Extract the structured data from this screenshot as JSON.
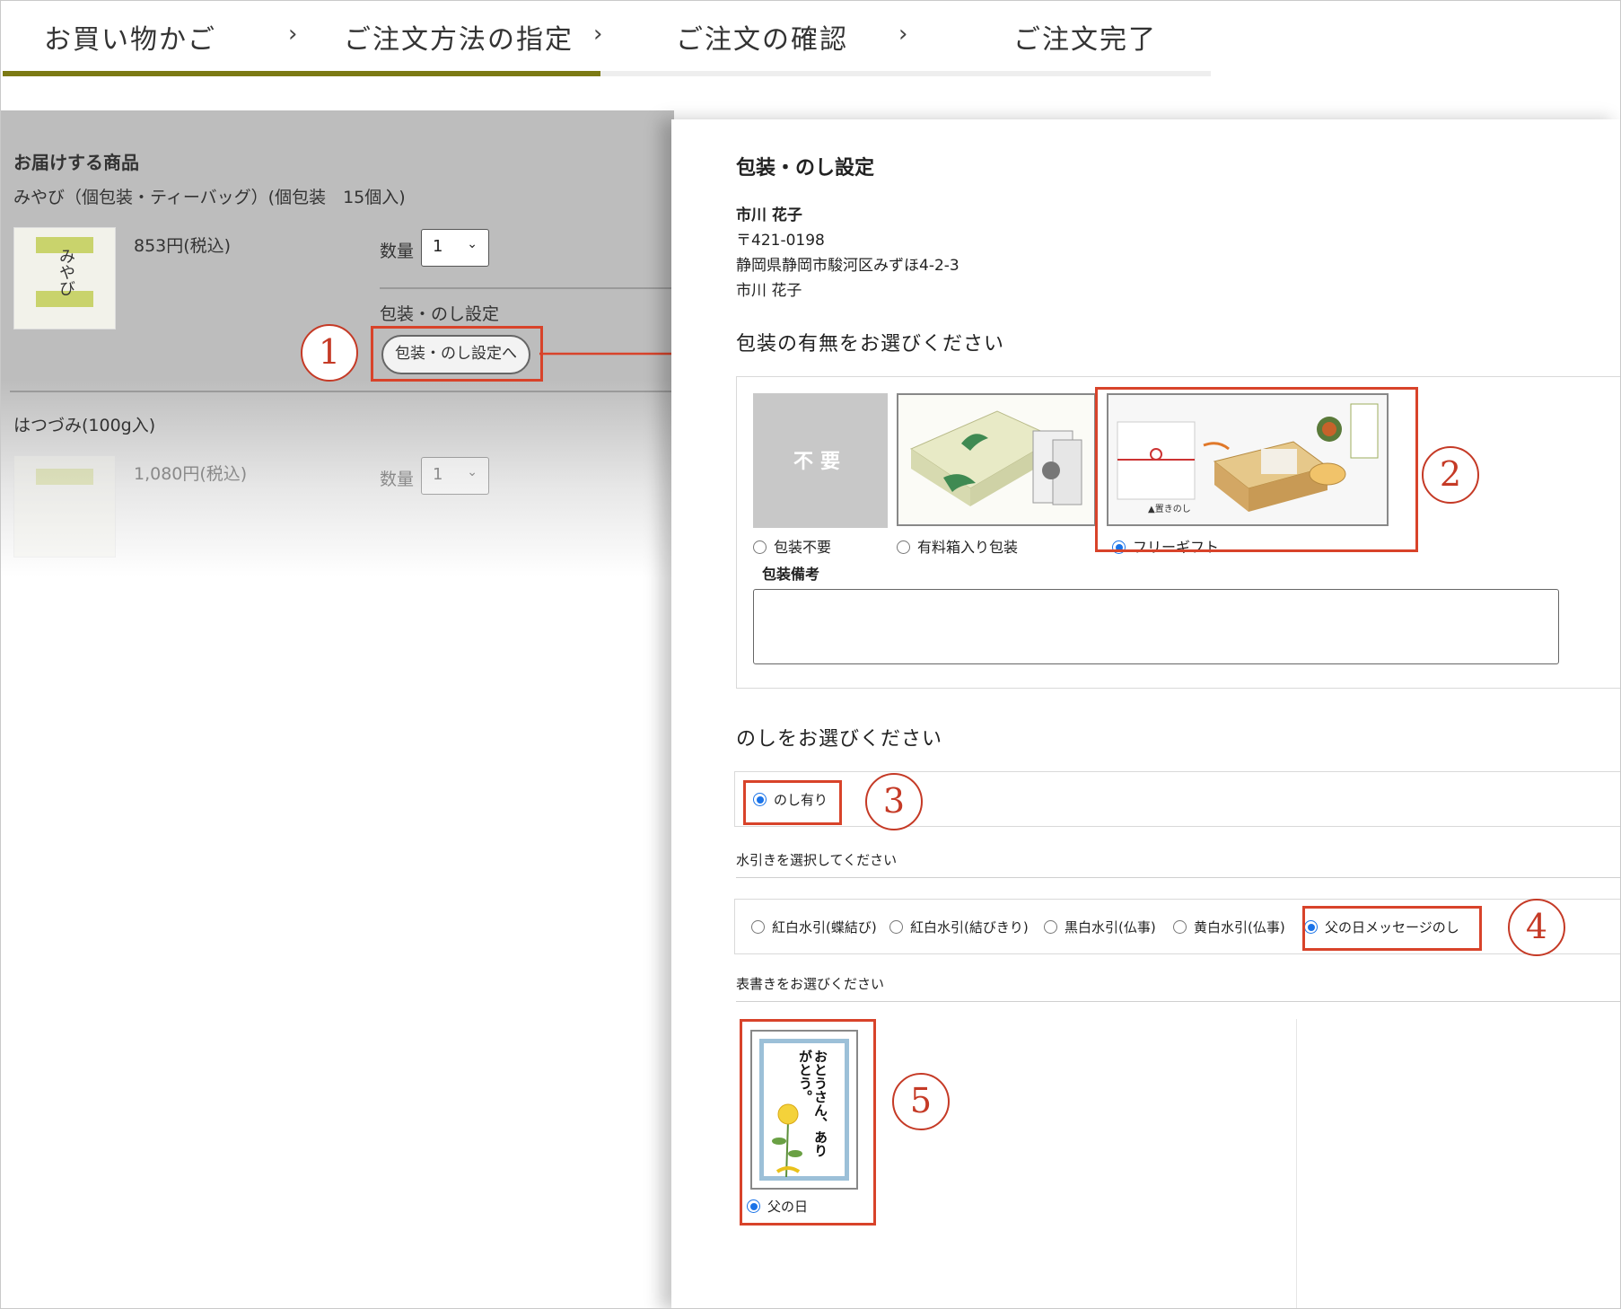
{
  "steps": {
    "items": [
      "お買い物かご",
      "ご注文方法の指定",
      "ご注文の確認",
      "ご注文完了"
    ],
    "chevron": "›"
  },
  "cart": {
    "section_title": "お届けする商品",
    "item1": {
      "name": "みやび（個包装・ティーバッグ）(個包装　15個入)",
      "price": "853円(税込)",
      "qty_label": "数量",
      "qty_value": "1",
      "wrap_label": "包装・のし設定",
      "wrap_button": "包装・のし設定へ",
      "thumb_text": "みやび"
    },
    "item2": {
      "name": "はつづみ(100g入)",
      "price": "1,080円(税込)",
      "qty_label": "数量",
      "qty_value": "1"
    }
  },
  "modal": {
    "title": "包装・のし設定",
    "recipient": {
      "name": "市川 花子",
      "postal": "〒421-0198",
      "address": "静岡県静岡市駿河区みずほ4-2-3",
      "name2": "市川 花子"
    },
    "wrap_heading": "包装の有無をお選びください",
    "wrap_options": [
      {
        "label": "包装不要",
        "image_text": "不要",
        "selected": false
      },
      {
        "label": "有料箱入り包装",
        "selected": false
      },
      {
        "label": "フリーギフト",
        "image_caption": "▲置きのし",
        "selected": true
      }
    ],
    "wrap_note_label": "包装備考",
    "wrap_note_value": "",
    "noshi_heading": "のしをお選びください",
    "noshi_option": "のし有り",
    "mizuhiki_heading": "水引きを選択してください",
    "mizuhiki_options": [
      "紅白水引(蝶結び)",
      "紅白水引(結びきり)",
      "黒白水引(仏事)",
      "黄白水引(仏事)",
      "父の日メッセージのし"
    ],
    "omote_heading": "表書きをお選びください",
    "omote_option": "父の日",
    "omote_card_text": "おとうさん、ありがとう。"
  },
  "annotations": [
    "1",
    "2",
    "3",
    "4",
    "5"
  ],
  "colors": {
    "accent_olive": "#7c7a14",
    "highlight_red": "#d8432a",
    "radio_blue": "#1a73e8"
  }
}
